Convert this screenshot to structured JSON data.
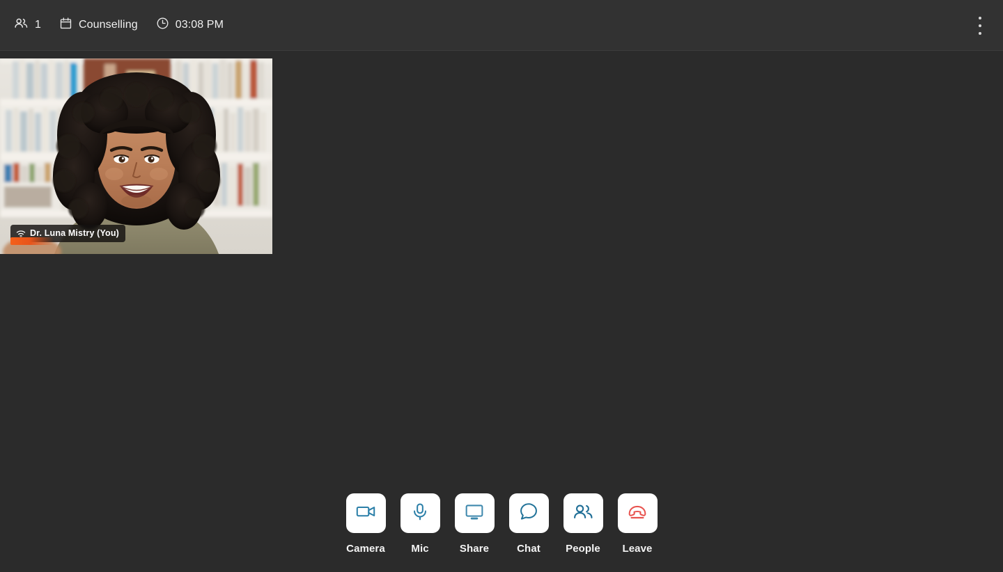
{
  "header": {
    "participants": {
      "icon": "people-icon",
      "count": "1"
    },
    "meeting": {
      "icon": "calendar-icon",
      "title": "Counselling"
    },
    "time": {
      "icon": "clock-icon",
      "value": "03:08 PM"
    },
    "menu": {
      "icon": "more-vertical-icon",
      "label": "More options"
    }
  },
  "stage": {
    "tiles": [
      {
        "name": "Dr. Luna Mistry (You)",
        "connection_icon": "wifi-icon",
        "is_self": true,
        "scene": "woman smiling in front of a bookshelf"
      }
    ]
  },
  "controls": [
    {
      "id": "camera",
      "label": "Camera",
      "icon": "video-camera-icon",
      "color": "#2B7FA8",
      "active": true
    },
    {
      "id": "mic",
      "label": "Mic",
      "icon": "microphone-icon",
      "color": "#2B7FA8",
      "active": true
    },
    {
      "id": "share",
      "label": "Share",
      "icon": "screen-share-icon",
      "color": "#3E88AD",
      "active": false
    },
    {
      "id": "chat",
      "label": "Chat",
      "icon": "chat-bubble-icon",
      "color": "#227399",
      "active": false
    },
    {
      "id": "people",
      "label": "People",
      "icon": "people-icon",
      "color": "#1F6E96",
      "active": false
    },
    {
      "id": "leave",
      "label": "Leave",
      "icon": "phone-hangup-icon",
      "color": "#E8534F",
      "active": false
    }
  ],
  "theme": {
    "app_background": "#2b2b2b",
    "header_background": "#323232",
    "button_background": "#ffffff",
    "accent_blue": "#2B7FA8",
    "danger_red": "#E8534F",
    "badge_accent": "#f4601a",
    "text_primary": "#f2f2f2"
  }
}
